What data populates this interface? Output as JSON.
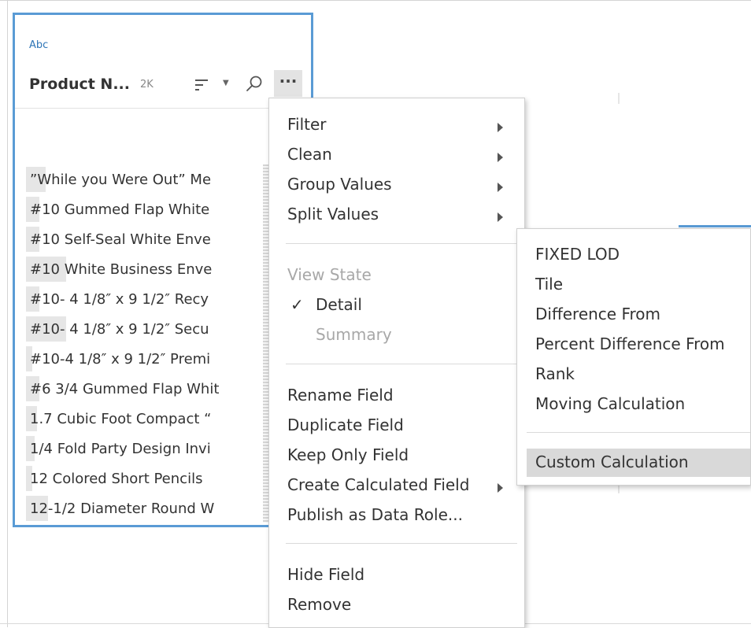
{
  "card": {
    "type_label": "Abc",
    "field_name": "Product N...",
    "count": "2K",
    "more_label": "···",
    "values": [
      {
        "text": "”While you Were Out” Me",
        "bar": 0.09
      },
      {
        "text": "#10 Gummed Flap White ",
        "bar": 0.06
      },
      {
        "text": "#10 Self-Seal White Enve",
        "bar": 0.06
      },
      {
        "text": "#10 White Business Enve",
        "bar": 0.18
      },
      {
        "text": "#10- 4 1/8″ x 9 1/2″ Recy",
        "bar": 0.06
      },
      {
        "text": "#10- 4 1/8″ x 9 1/2″ Secu",
        "bar": 0.18
      },
      {
        "text": "#10-4 1/8″ x 9 1/2″ Premi",
        "bar": 0.03
      },
      {
        "text": "#6 3/4 Gummed Flap Whit",
        "bar": 0.06
      },
      {
        "text": "1.7 Cubic Foot Compact “",
        "bar": 0.05
      },
      {
        "text": "1/4 Fold Party Design Invi",
        "bar": 0.04
      },
      {
        "text": "12 Colored Short Pencils",
        "bar": 0.03
      },
      {
        "text": "12-1/2 Diameter Round W",
        "bar": 0.1
      }
    ]
  },
  "menu": {
    "filter": "Filter",
    "clean": "Clean",
    "group_values": "Group Values",
    "split_values": "Split Values",
    "view_state": "View State",
    "check": "✓",
    "detail": "Detail",
    "summary": "Summary",
    "rename_field": "Rename Field",
    "duplicate_field": "Duplicate Field",
    "keep_only_field": "Keep Only Field",
    "create_calculated_field": "Create Calculated Field",
    "publish_as_data_role": "Publish as Data Role...",
    "hide_field": "Hide Field",
    "remove": "Remove"
  },
  "submenu": {
    "items": [
      "FIXED LOD",
      "Tile",
      "Difference From",
      "Percent Difference From",
      "Rank",
      "Moving Calculation"
    ],
    "custom_calculation": "Custom Calculation"
  },
  "colors": {
    "accent": "#5a9bd5",
    "type_label": "#2e75b6",
    "hover": "#d9d9d9"
  }
}
